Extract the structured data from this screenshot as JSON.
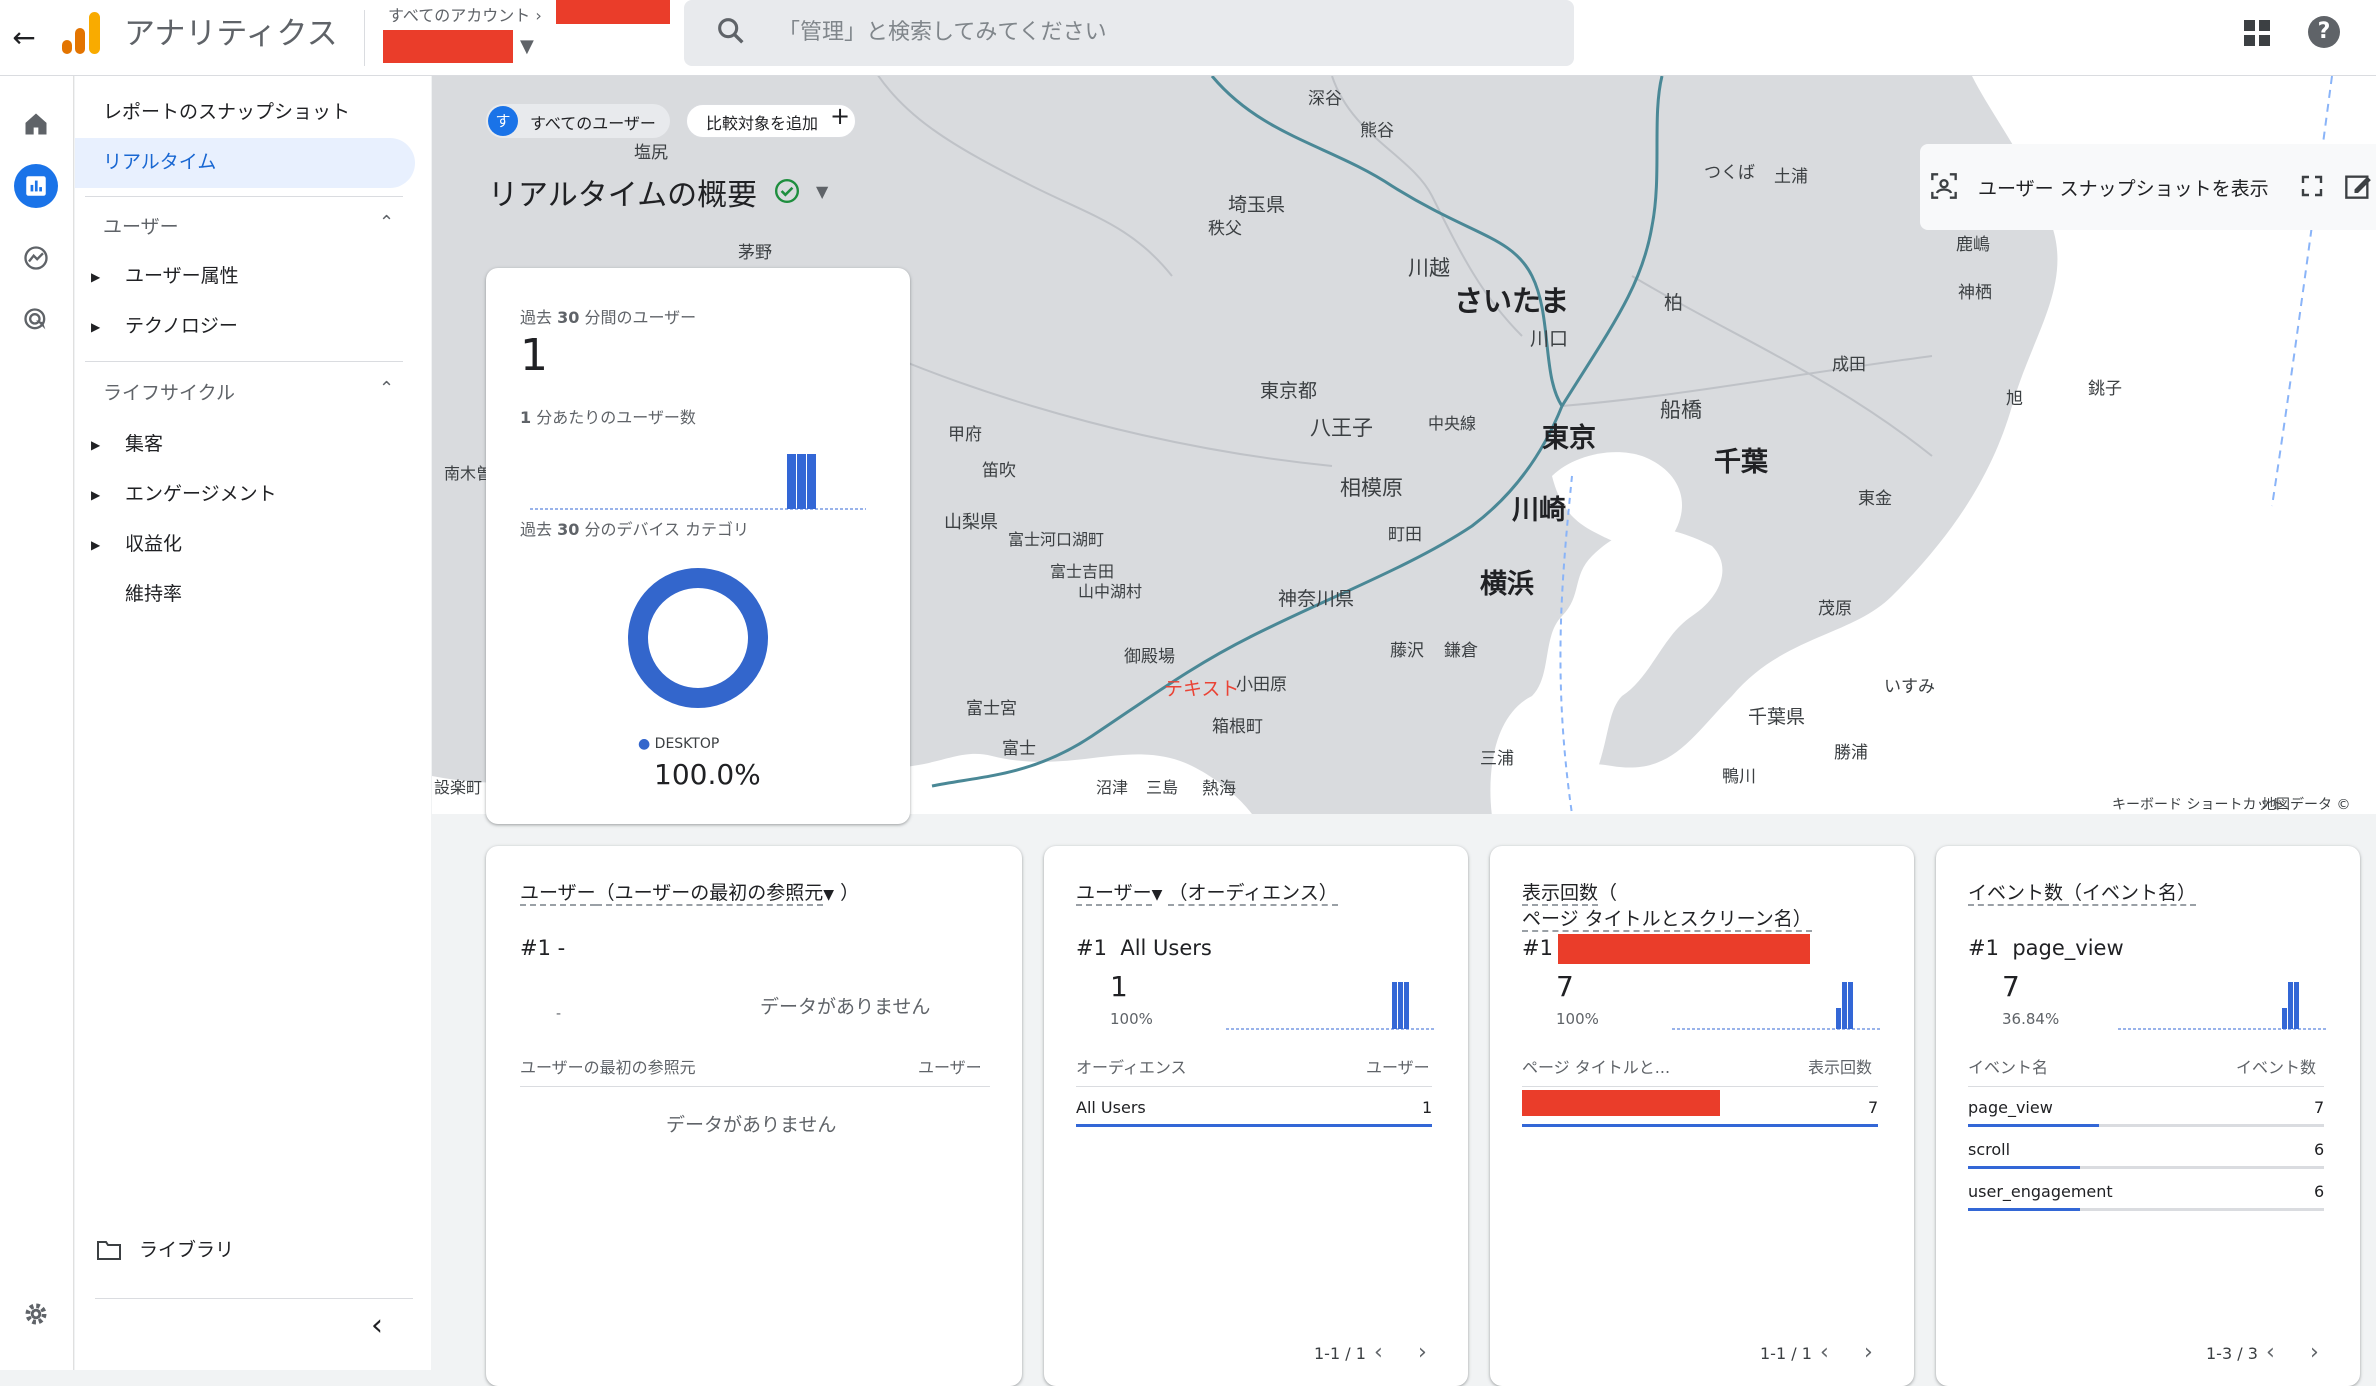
{
  "header": {
    "back_icon": "arrow-left-icon",
    "app_title": "アナリティクス",
    "account_crumb": "すべてのアカウント",
    "search_placeholder": "「管理」と検索してみてください"
  },
  "nav": {
    "snapshot": "レポートのスナップショット",
    "realtime": "リアルタイム",
    "user_section": "ユーザー",
    "user_attributes": "ユーザー属性",
    "technology": "テクノロジー",
    "lifecycle_section": "ライフサイクル",
    "acquisition": "集客",
    "engagement": "エンゲージメント",
    "monetization": "収益化",
    "retention": "維持率",
    "library": "ライブラリ"
  },
  "toolbar": {
    "segment_avatar": "す",
    "segment_chip": "すべてのユーザー",
    "add_compare": "比較対象を追加",
    "page_title": "リアルタイムの概要",
    "snapshot_button": "ユーザー スナップショットを表示"
  },
  "map": {
    "labels": [
      "深谷",
      "熊谷",
      "埼玉県",
      "秩父",
      "塩尻",
      "茅野",
      "川越",
      "さいたま",
      "川口",
      "柏",
      "つくば",
      "土浦",
      "鹿嶋",
      "神栖",
      "成田",
      "東京都",
      "八王子",
      "東京",
      "船橋",
      "千葉",
      "銚子",
      "旭",
      "中央線",
      "相模原",
      "町田",
      "川崎",
      "横浜",
      "東金",
      "甲府",
      "笛吹",
      "山梨県",
      "富士河口湖町",
      "富士吉田",
      "山中湖村",
      "神奈川県",
      "茂原",
      "御殿場",
      "藤沢",
      "鎌倉",
      "小田原",
      "いすみ",
      "富士宮",
      "箱根町",
      "千葉県",
      "富士",
      "三浦",
      "勝浦",
      "沼津",
      "三島",
      "熱海",
      "鴨川",
      "南木曽",
      "設楽町",
      "テキスト"
    ],
    "footer_shortcuts": "キーボード ショートカット",
    "footer_mapdata": "地図データ ©"
  },
  "summary_card": {
    "users_label_prefix": "過去 ",
    "users_label_num": "30",
    "users_label_suffix": " 分間のユーザー",
    "users_value": "1",
    "per_minute_label_prefix": "1",
    "per_minute_label_suffix": " 分あたりのユーザー数",
    "device_label_prefix": "過去 ",
    "device_label_num": "30",
    "device_label_suffix": " 分のデバイス カテゴリ",
    "legend_device": "DESKTOP",
    "device_percent": "100.0%"
  },
  "card_source": {
    "metric": "ユーザー",
    "dimension": "（ユーザーの最初の参照元",
    "dimension_end": "）",
    "rank": "#1",
    "rank_value": "-",
    "dash": "-",
    "no_data": "データがありません",
    "col_dim": "ユーザーの最初の参照元",
    "col_metric": "ユーザー",
    "table_no_data": "データがありません"
  },
  "card_audience": {
    "metric": "ユーザー",
    "dimension": "（オーディエンス）",
    "rank": "#1",
    "rank_value": "All Users",
    "value": "1",
    "percent": "100%",
    "col_dim": "オーディエンス",
    "col_metric": "ユーザー",
    "rows": [
      {
        "name": "All Users",
        "value": "1",
        "share": 1.0
      }
    ],
    "pagination": "1-1 / 1"
  },
  "card_pages": {
    "metric": "表示回数",
    "dimension_line1": "（",
    "dimension_line2": "ページ タイトルとスクリーン名）",
    "rank": "#1",
    "value": "7",
    "percent": "100%",
    "col_dim": "ページ タイトルと...",
    "col_metric": "表示回数",
    "rows": [
      {
        "value": "7",
        "share": 1.0
      }
    ],
    "pagination": "1-1 / 1"
  },
  "card_events": {
    "metric": "イベント数",
    "dimension": "（イベント名）",
    "rank": "#1",
    "rank_value": "page_view",
    "value": "7",
    "percent": "36.84%",
    "col_dim": "イベント名",
    "col_metric": "イベント数",
    "rows": [
      {
        "name": "page_view",
        "value": "7",
        "share": 0.3684
      },
      {
        "name": "scroll",
        "value": "6",
        "share": 0.3158
      },
      {
        "name": "user_engagement",
        "value": "6",
        "share": 0.3158
      }
    ],
    "pagination": "1-3 / 3"
  },
  "colors": {
    "accent": "#1a73e8",
    "bar": "#3367d6",
    "redact": "#ea3d2a",
    "donut": "#3366cc",
    "check": "#1e8e3e"
  }
}
